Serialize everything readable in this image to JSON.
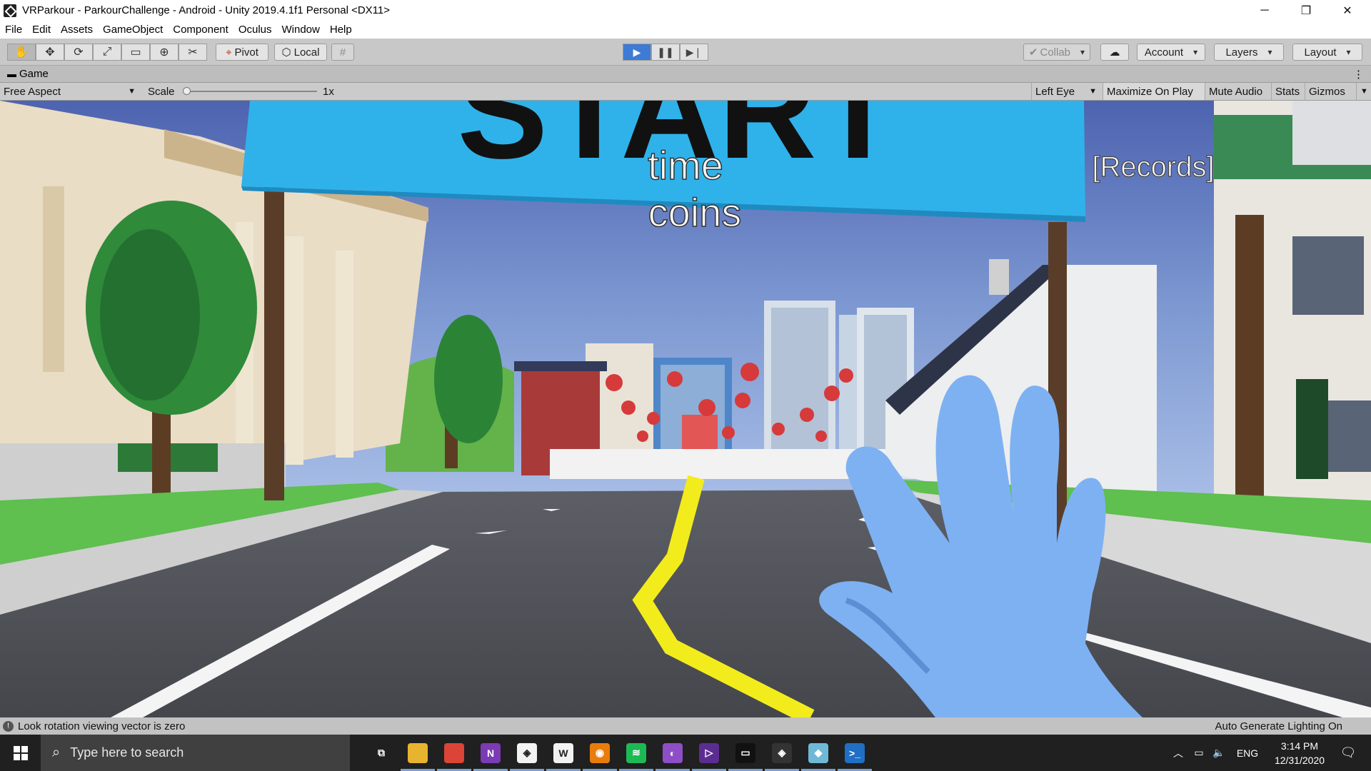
{
  "window": {
    "title": "VRParkour - ParkourChallenge - Android - Unity 2019.4.1f1 Personal <DX11>",
    "minimize": "─",
    "restore": "❐",
    "close": "✕"
  },
  "menu": [
    "File",
    "Edit",
    "Assets",
    "GameObject",
    "Component",
    "Oculus",
    "Window",
    "Help"
  ],
  "toolbar": {
    "pivot": "Pivot",
    "local": "Local",
    "collab": "Collab",
    "account": "Account",
    "layers": "Layers",
    "layout": "Layout"
  },
  "game_tab": {
    "label": "Game",
    "menu_dots": "⋮"
  },
  "game_bar": {
    "aspect": "Free Aspect",
    "scale_label": "Scale",
    "scale_value": "1x",
    "scale_fraction": 0,
    "eye": "Left Eye",
    "maximize": "Maximize On Play",
    "mute": "Mute Audio",
    "stats": "Stats",
    "gizmos": "Gizmos"
  },
  "scene": {
    "banner_text": "START",
    "time_label": "time",
    "coins_label": "coins",
    "records_label": "[Records]",
    "banner_color": "#2fb2ea",
    "sky_color": "#6b86c6",
    "road_color": "#4a4c52",
    "hand_color": "#7eb1f2"
  },
  "status": {
    "message": "Look rotation viewing vector is zero",
    "lighting": "Auto Generate Lighting On"
  },
  "taskbar": {
    "search_placeholder": "Type here to search",
    "apps": [
      {
        "name": "task-view",
        "glyph": "⧉",
        "color": "#202020"
      },
      {
        "name": "file-explorer",
        "glyph": "",
        "color": "#e8b32e"
      },
      {
        "name": "chrome",
        "glyph": "",
        "color": "#db4437"
      },
      {
        "name": "onenote",
        "glyph": "N",
        "color": "#7a3bb5"
      },
      {
        "name": "unity-hub",
        "glyph": "◈",
        "color": "#f2f2f2"
      },
      {
        "name": "word",
        "glyph": "W",
        "color": "#f2f2f2"
      },
      {
        "name": "blender",
        "glyph": "◉",
        "color": "#e87d0d"
      },
      {
        "name": "spotify",
        "glyph": "≋",
        "color": "#1db954"
      },
      {
        "name": "github-desktop",
        "glyph": "◐",
        "color": "#8e4ec6"
      },
      {
        "name": "visual-studio",
        "glyph": "▷",
        "color": "#5c2d91"
      },
      {
        "name": "oculus",
        "glyph": "▭",
        "color": "#111111"
      },
      {
        "name": "unity",
        "glyph": "◈",
        "color": "#333333"
      },
      {
        "name": "sketch-app",
        "glyph": "◆",
        "color": "#6fb9d6"
      },
      {
        "name": "powershell",
        "glyph": ">_",
        "color": "#1f6fc5"
      }
    ],
    "lang": "ENG",
    "time": "3:14 PM",
    "date": "12/31/2020"
  }
}
